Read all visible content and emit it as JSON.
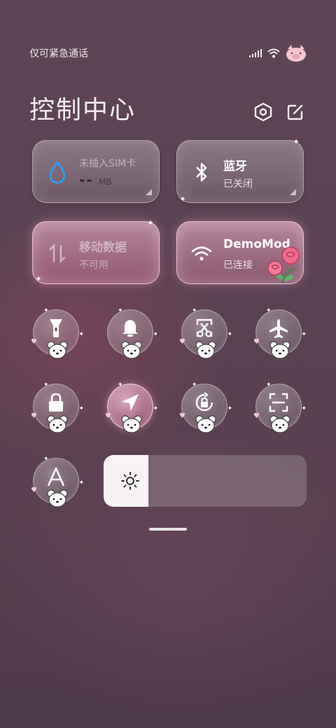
{
  "status_bar": {
    "carrier_text": "仅可紧急通话",
    "icons": [
      "signal-icon",
      "wifi-icon",
      "pig-avatar-icon"
    ]
  },
  "header": {
    "title": "控制中心",
    "settings_icon": "settings-hexagon-icon",
    "edit_icon": "edit-icon"
  },
  "tiles": {
    "data_usage": {
      "title": "未插入SIM卡",
      "amount": "--",
      "unit": "MB",
      "icon": "water-drop-icon"
    },
    "bluetooth": {
      "title": "蓝牙",
      "subtitle": "已关闭",
      "icon": "bluetooth-icon"
    },
    "mobile_data": {
      "title": "移动数据",
      "subtitle": "不可用",
      "icon": "data-arrows-icon"
    },
    "wifi": {
      "title": "DemoMod",
      "subtitle": "已连接",
      "icon": "wifi-icon",
      "decoration": "rose-sticker"
    }
  },
  "toggles": [
    {
      "name": "flashlight",
      "icon": "flashlight-icon",
      "active": false
    },
    {
      "name": "silent",
      "icon": "bell-icon",
      "active": false
    },
    {
      "name": "screenshot",
      "icon": "scissors-icon",
      "active": false
    },
    {
      "name": "airplane",
      "icon": "airplane-icon",
      "active": false
    },
    {
      "name": "lock",
      "icon": "lock-icon",
      "active": false
    },
    {
      "name": "location",
      "icon": "location-arrow-icon",
      "active": true
    },
    {
      "name": "rotation-lock",
      "icon": "rotation-lock-icon",
      "active": false
    },
    {
      "name": "scanner",
      "icon": "scan-icon",
      "active": false
    },
    {
      "name": "font-size",
      "icon": "letter-a-icon",
      "active": false
    }
  ],
  "brightness": {
    "level": 0.22,
    "icon": "sun-icon"
  },
  "colors": {
    "accent_pink": "#ffb6cf",
    "data_icon_blue": "#2f9bff",
    "background": "#5a4252"
  }
}
